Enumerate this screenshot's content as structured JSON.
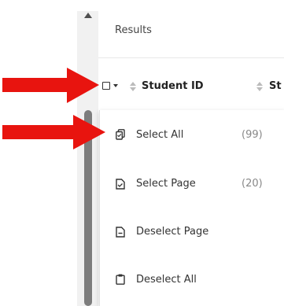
{
  "results": {
    "title": "Results"
  },
  "columns": [
    {
      "label": "Student ID"
    },
    {
      "label": "St"
    }
  ],
  "menu": {
    "items": [
      {
        "label": "Select All",
        "count": "(99)",
        "icon": "select-all-icon"
      },
      {
        "label": "Select Page",
        "count": "(20)",
        "icon": "select-page-icon"
      },
      {
        "label": "Deselect Page",
        "count": "",
        "icon": "deselect-page-icon"
      },
      {
        "label": "Deselect All",
        "count": "",
        "icon": "deselect-all-icon"
      }
    ]
  },
  "annotations": {
    "arrow_color": "#e8140f"
  }
}
